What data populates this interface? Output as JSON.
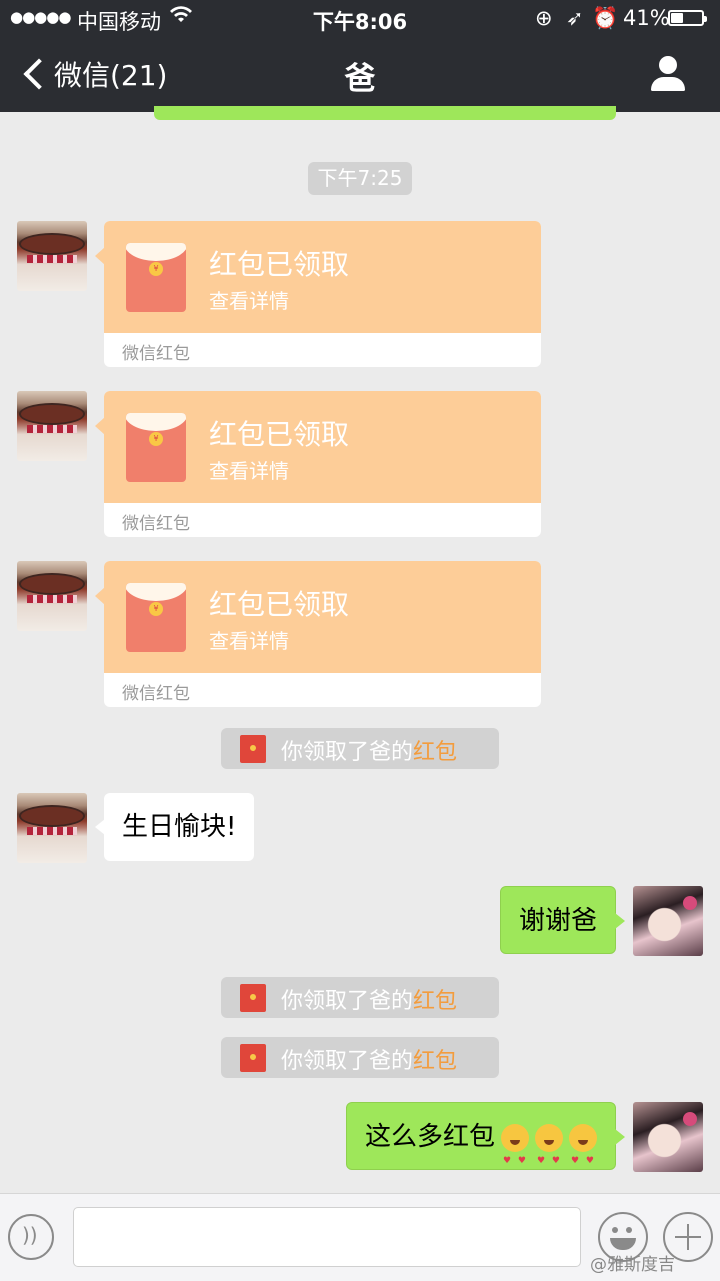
{
  "status": {
    "signal_dots": "●●●●●",
    "carrier": "中国移动",
    "time": "下午8:06",
    "battery_pct": "41%",
    "battery_level": 0.41
  },
  "nav": {
    "back_label": "微信(21)",
    "title": "爸"
  },
  "chat": {
    "time_divider": "下午7:25",
    "red_packets": [
      {
        "title": "红包已领取",
        "subtitle": "查看详情",
        "footer": "微信红包"
      },
      {
        "title": "红包已领取",
        "subtitle": "查看详情",
        "footer": "微信红包"
      },
      {
        "title": "红包已领取",
        "subtitle": "查看详情",
        "footer": "微信红包"
      }
    ],
    "system_notice": {
      "prefix": "你领取了爸的",
      "highlight": "红包"
    },
    "messages": {
      "dad_birthday": "生日愉块!",
      "me_thanks": "谢谢爸",
      "me_so_many": "这么多红包"
    }
  },
  "watermark": "@雅斯度吉",
  "colors": {
    "nav_bg": "#2b2d32",
    "chat_bg": "#ebebeb",
    "sent_bubble": "#9ee75a",
    "red_packet": "#fdcd98",
    "highlight": "#f39c3d"
  }
}
